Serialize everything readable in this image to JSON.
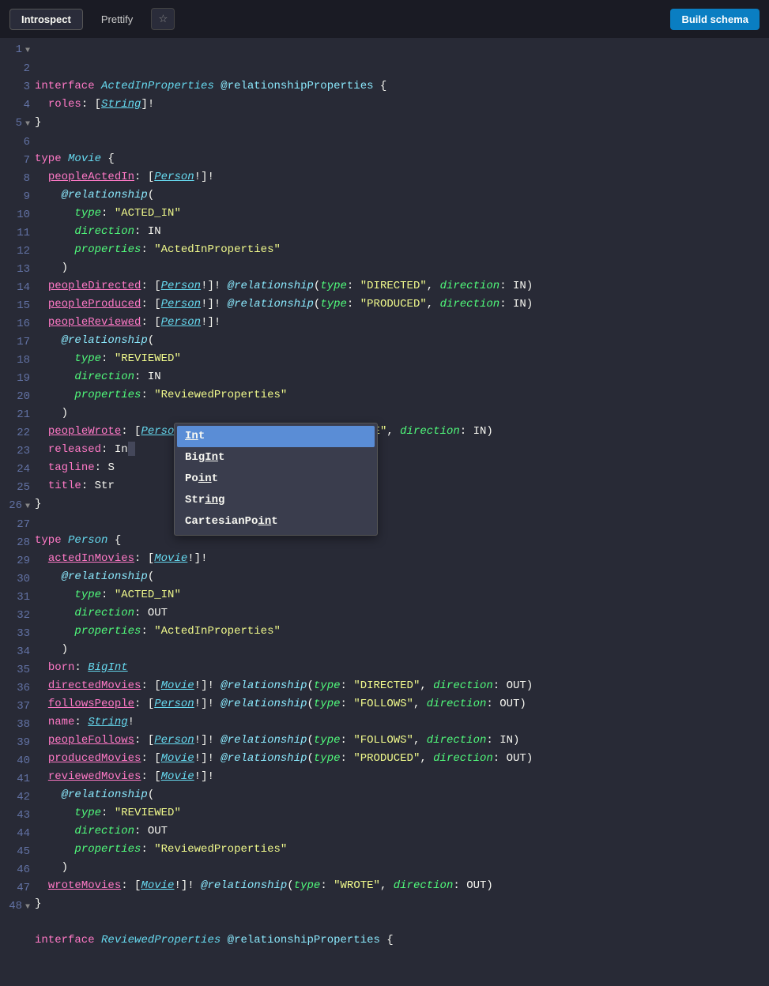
{
  "toolbar": {
    "introspect": "Introspect",
    "prettify": "Prettify",
    "star": "☆",
    "build": "Build schema"
  },
  "lines": [
    {
      "n": 1,
      "fold": true,
      "tokens": [
        [
          "kw",
          "interface"
        ],
        [
          "punc",
          " "
        ],
        [
          "type",
          "ActedInProperties"
        ],
        [
          "punc",
          " "
        ],
        [
          "dir",
          "@relationshipProperties"
        ],
        [
          "punc",
          " {"
        ]
      ]
    },
    {
      "n": 2,
      "tokens": [
        [
          "punc",
          "  "
        ],
        [
          "field",
          "roles"
        ],
        [
          "punc",
          ": ["
        ],
        [
          "ref",
          "String"
        ],
        [
          "punc",
          "]!"
        ]
      ]
    },
    {
      "n": 3,
      "tokens": [
        [
          "punc",
          "}"
        ]
      ]
    },
    {
      "n": 4,
      "tokens": []
    },
    {
      "n": 5,
      "fold": true,
      "tokens": [
        [
          "kw",
          "type"
        ],
        [
          "punc",
          " "
        ],
        [
          "type",
          "Movie"
        ],
        [
          "punc",
          " {"
        ]
      ]
    },
    {
      "n": 6,
      "tokens": [
        [
          "punc",
          "  "
        ],
        [
          "fieldp",
          "peopleActedIn"
        ],
        [
          "punc",
          ": ["
        ],
        [
          "ref",
          "Person"
        ],
        [
          "punc",
          "!]!"
        ]
      ]
    },
    {
      "n": 7,
      "tokens": [
        [
          "punc",
          "    "
        ],
        [
          "dirkw",
          "@relationship"
        ],
        [
          "punc",
          "("
        ]
      ]
    },
    {
      "n": 8,
      "tokens": [
        [
          "punc",
          "      "
        ],
        [
          "attr",
          "type"
        ],
        [
          "punc",
          ": "
        ],
        [
          "str",
          "\"ACTED_IN\""
        ]
      ]
    },
    {
      "n": 9,
      "tokens": [
        [
          "punc",
          "      "
        ],
        [
          "attr",
          "direction"
        ],
        [
          "punc",
          ": "
        ],
        [
          "val",
          "IN"
        ]
      ]
    },
    {
      "n": 10,
      "tokens": [
        [
          "punc",
          "      "
        ],
        [
          "attr",
          "properties"
        ],
        [
          "punc",
          ": "
        ],
        [
          "str",
          "\"ActedInProperties\""
        ]
      ]
    },
    {
      "n": 11,
      "tokens": [
        [
          "punc",
          "    )"
        ]
      ]
    },
    {
      "n": 12,
      "tokens": [
        [
          "punc",
          "  "
        ],
        [
          "fieldp",
          "peopleDirected"
        ],
        [
          "punc",
          ": ["
        ],
        [
          "ref",
          "Person"
        ],
        [
          "punc",
          "!]! "
        ],
        [
          "dirkw",
          "@relationship"
        ],
        [
          "punc",
          "("
        ],
        [
          "attr",
          "type"
        ],
        [
          "punc",
          ": "
        ],
        [
          "str",
          "\"DIRECTED\""
        ],
        [
          "punc",
          ", "
        ],
        [
          "attr",
          "direction"
        ],
        [
          "punc",
          ": "
        ],
        [
          "val",
          "IN"
        ],
        [
          "punc",
          ")"
        ]
      ]
    },
    {
      "n": 13,
      "tokens": [
        [
          "punc",
          "  "
        ],
        [
          "fieldp",
          "peopleProduced"
        ],
        [
          "punc",
          ": ["
        ],
        [
          "ref",
          "Person"
        ],
        [
          "punc",
          "!]! "
        ],
        [
          "dirkw",
          "@relationship"
        ],
        [
          "punc",
          "("
        ],
        [
          "attr",
          "type"
        ],
        [
          "punc",
          ": "
        ],
        [
          "str",
          "\"PRODUCED\""
        ],
        [
          "punc",
          ", "
        ],
        [
          "attr",
          "direction"
        ],
        [
          "punc",
          ": "
        ],
        [
          "val",
          "IN"
        ],
        [
          "punc",
          ")"
        ]
      ]
    },
    {
      "n": 14,
      "tokens": [
        [
          "punc",
          "  "
        ],
        [
          "fieldp",
          "peopleReviewed"
        ],
        [
          "punc",
          ": ["
        ],
        [
          "ref",
          "Person"
        ],
        [
          "punc",
          "!]!"
        ]
      ]
    },
    {
      "n": 15,
      "tokens": [
        [
          "punc",
          "    "
        ],
        [
          "dirkw",
          "@relationship"
        ],
        [
          "punc",
          "("
        ]
      ]
    },
    {
      "n": 16,
      "tokens": [
        [
          "punc",
          "      "
        ],
        [
          "attr",
          "type"
        ],
        [
          "punc",
          ": "
        ],
        [
          "str",
          "\"REVIEWED\""
        ]
      ]
    },
    {
      "n": 17,
      "tokens": [
        [
          "punc",
          "      "
        ],
        [
          "attr",
          "direction"
        ],
        [
          "punc",
          ": "
        ],
        [
          "val",
          "IN"
        ]
      ]
    },
    {
      "n": 18,
      "tokens": [
        [
          "punc",
          "      "
        ],
        [
          "attr",
          "properties"
        ],
        [
          "punc",
          ": "
        ],
        [
          "str",
          "\"ReviewedProperties\""
        ]
      ]
    },
    {
      "n": 19,
      "tokens": [
        [
          "punc",
          "    )"
        ]
      ]
    },
    {
      "n": 20,
      "tokens": [
        [
          "punc",
          "  "
        ],
        [
          "fieldp",
          "peopleWrote"
        ],
        [
          "punc",
          ": ["
        ],
        [
          "ref",
          "Person"
        ],
        [
          "punc",
          "!]! "
        ],
        [
          "dirkw",
          "@relationship"
        ],
        [
          "punc",
          "("
        ],
        [
          "attr",
          "type"
        ],
        [
          "punc",
          ": "
        ],
        [
          "str",
          "\"WROTE\""
        ],
        [
          "punc",
          ", "
        ],
        [
          "attr",
          "direction"
        ],
        [
          "punc",
          ": "
        ],
        [
          "val",
          "IN"
        ],
        [
          "punc",
          ")"
        ]
      ]
    },
    {
      "n": 21,
      "tokens": [
        [
          "punc",
          "  "
        ],
        [
          "field",
          "released"
        ],
        [
          "punc",
          ": "
        ],
        [
          "val",
          "In"
        ],
        [
          "cursor",
          ""
        ]
      ]
    },
    {
      "n": 22,
      "tokens": [
        [
          "punc",
          "  "
        ],
        [
          "field",
          "tagline"
        ],
        [
          "punc",
          ": "
        ],
        [
          "val",
          "S"
        ]
      ]
    },
    {
      "n": 23,
      "tokens": [
        [
          "punc",
          "  "
        ],
        [
          "field",
          "title"
        ],
        [
          "punc",
          ": "
        ],
        [
          "val",
          "Str"
        ]
      ]
    },
    {
      "n": 24,
      "tokens": [
        [
          "punc",
          "}"
        ]
      ]
    },
    {
      "n": 25,
      "tokens": []
    },
    {
      "n": 26,
      "fold": true,
      "tokens": [
        [
          "kw",
          "type"
        ],
        [
          "punc",
          " "
        ],
        [
          "type",
          "Person"
        ],
        [
          "punc",
          " {"
        ]
      ]
    },
    {
      "n": 27,
      "tokens": [
        [
          "punc",
          "  "
        ],
        [
          "fieldp",
          "actedInMovies"
        ],
        [
          "punc",
          ": ["
        ],
        [
          "ref",
          "Movie"
        ],
        [
          "punc",
          "!]!"
        ]
      ]
    },
    {
      "n": 28,
      "tokens": [
        [
          "punc",
          "    "
        ],
        [
          "dirkw",
          "@relationship"
        ],
        [
          "punc",
          "("
        ]
      ]
    },
    {
      "n": 29,
      "tokens": [
        [
          "punc",
          "      "
        ],
        [
          "attr",
          "type"
        ],
        [
          "punc",
          ": "
        ],
        [
          "str",
          "\"ACTED_IN\""
        ]
      ]
    },
    {
      "n": 30,
      "tokens": [
        [
          "punc",
          "      "
        ],
        [
          "attr",
          "direction"
        ],
        [
          "punc",
          ": "
        ],
        [
          "val",
          "OUT"
        ]
      ]
    },
    {
      "n": 31,
      "tokens": [
        [
          "punc",
          "      "
        ],
        [
          "attr",
          "properties"
        ],
        [
          "punc",
          ": "
        ],
        [
          "str",
          "\"ActedInProperties\""
        ]
      ]
    },
    {
      "n": 32,
      "tokens": [
        [
          "punc",
          "    )"
        ]
      ]
    },
    {
      "n": 33,
      "tokens": [
        [
          "punc",
          "  "
        ],
        [
          "field",
          "born"
        ],
        [
          "punc",
          ": "
        ],
        [
          "ref",
          "BigInt"
        ]
      ]
    },
    {
      "n": 34,
      "tokens": [
        [
          "punc",
          "  "
        ],
        [
          "fieldp",
          "directedMovies"
        ],
        [
          "punc",
          ": ["
        ],
        [
          "ref",
          "Movie"
        ],
        [
          "punc",
          "!]! "
        ],
        [
          "dirkw",
          "@relationship"
        ],
        [
          "punc",
          "("
        ],
        [
          "attr",
          "type"
        ],
        [
          "punc",
          ": "
        ],
        [
          "str",
          "\"DIRECTED\""
        ],
        [
          "punc",
          ", "
        ],
        [
          "attr",
          "direction"
        ],
        [
          "punc",
          ": "
        ],
        [
          "val",
          "OUT"
        ],
        [
          "punc",
          ")"
        ]
      ]
    },
    {
      "n": 35,
      "tokens": [
        [
          "punc",
          "  "
        ],
        [
          "fieldp",
          "followsPeople"
        ],
        [
          "punc",
          ": ["
        ],
        [
          "ref",
          "Person"
        ],
        [
          "punc",
          "!]! "
        ],
        [
          "dirkw",
          "@relationship"
        ],
        [
          "punc",
          "("
        ],
        [
          "attr",
          "type"
        ],
        [
          "punc",
          ": "
        ],
        [
          "str",
          "\"FOLLOWS\""
        ],
        [
          "punc",
          ", "
        ],
        [
          "attr",
          "direction"
        ],
        [
          "punc",
          ": "
        ],
        [
          "val",
          "OUT"
        ],
        [
          "punc",
          ")"
        ]
      ]
    },
    {
      "n": 36,
      "tokens": [
        [
          "punc",
          "  "
        ],
        [
          "field",
          "name"
        ],
        [
          "punc",
          ": "
        ],
        [
          "ref",
          "String"
        ],
        [
          "punc",
          "!"
        ]
      ]
    },
    {
      "n": 37,
      "tokens": [
        [
          "punc",
          "  "
        ],
        [
          "fieldp",
          "peopleFollows"
        ],
        [
          "punc",
          ": ["
        ],
        [
          "ref",
          "Person"
        ],
        [
          "punc",
          "!]! "
        ],
        [
          "dirkw",
          "@relationship"
        ],
        [
          "punc",
          "("
        ],
        [
          "attr",
          "type"
        ],
        [
          "punc",
          ": "
        ],
        [
          "str",
          "\"FOLLOWS\""
        ],
        [
          "punc",
          ", "
        ],
        [
          "attr",
          "direction"
        ],
        [
          "punc",
          ": "
        ],
        [
          "val",
          "IN"
        ],
        [
          "punc",
          ")"
        ]
      ]
    },
    {
      "n": 38,
      "tokens": [
        [
          "punc",
          "  "
        ],
        [
          "fieldp",
          "producedMovies"
        ],
        [
          "punc",
          ": ["
        ],
        [
          "ref",
          "Movie"
        ],
        [
          "punc",
          "!]! "
        ],
        [
          "dirkw",
          "@relationship"
        ],
        [
          "punc",
          "("
        ],
        [
          "attr",
          "type"
        ],
        [
          "punc",
          ": "
        ],
        [
          "str",
          "\"PRODUCED\""
        ],
        [
          "punc",
          ", "
        ],
        [
          "attr",
          "direction"
        ],
        [
          "punc",
          ": "
        ],
        [
          "val",
          "OUT"
        ],
        [
          "punc",
          ")"
        ]
      ]
    },
    {
      "n": 39,
      "tokens": [
        [
          "punc",
          "  "
        ],
        [
          "fieldp",
          "reviewedMovies"
        ],
        [
          "punc",
          ": ["
        ],
        [
          "ref",
          "Movie"
        ],
        [
          "punc",
          "!]!"
        ]
      ]
    },
    {
      "n": 40,
      "tokens": [
        [
          "punc",
          "    "
        ],
        [
          "dirkw",
          "@relationship"
        ],
        [
          "punc",
          "("
        ]
      ]
    },
    {
      "n": 41,
      "tokens": [
        [
          "punc",
          "      "
        ],
        [
          "attr",
          "type"
        ],
        [
          "punc",
          ": "
        ],
        [
          "str",
          "\"REVIEWED\""
        ]
      ]
    },
    {
      "n": 42,
      "tokens": [
        [
          "punc",
          "      "
        ],
        [
          "attr",
          "direction"
        ],
        [
          "punc",
          ": "
        ],
        [
          "val",
          "OUT"
        ]
      ]
    },
    {
      "n": 43,
      "tokens": [
        [
          "punc",
          "      "
        ],
        [
          "attr",
          "properties"
        ],
        [
          "punc",
          ": "
        ],
        [
          "str",
          "\"ReviewedProperties\""
        ]
      ]
    },
    {
      "n": 44,
      "tokens": [
        [
          "punc",
          "    )"
        ]
      ]
    },
    {
      "n": 45,
      "tokens": [
        [
          "punc",
          "  "
        ],
        [
          "fieldp",
          "wroteMovies"
        ],
        [
          "punc",
          ": ["
        ],
        [
          "ref",
          "Movie"
        ],
        [
          "punc",
          "!]! "
        ],
        [
          "dirkw",
          "@relationship"
        ],
        [
          "punc",
          "("
        ],
        [
          "attr",
          "type"
        ],
        [
          "punc",
          ": "
        ],
        [
          "str",
          "\"WROTE\""
        ],
        [
          "punc",
          ", "
        ],
        [
          "attr",
          "direction"
        ],
        [
          "punc",
          ": "
        ],
        [
          "val",
          "OUT"
        ],
        [
          "punc",
          ")"
        ]
      ]
    },
    {
      "n": 46,
      "tokens": [
        [
          "punc",
          "}"
        ]
      ]
    },
    {
      "n": 47,
      "tokens": []
    },
    {
      "n": 48,
      "fold": true,
      "tokens": [
        [
          "kw",
          "interface"
        ],
        [
          "punc",
          " "
        ],
        [
          "type",
          "ReviewedProperties"
        ],
        [
          "punc",
          " "
        ],
        [
          "dir",
          "@relationshipProperties"
        ],
        [
          "punc",
          " {"
        ]
      ]
    }
  ],
  "autocomplete": {
    "selected": 0,
    "items": [
      {
        "pre": "",
        "match": "In",
        "post": "t"
      },
      {
        "pre": "Big",
        "match": "In",
        "post": "t"
      },
      {
        "pre": "Po",
        "match": "in",
        "post": "t"
      },
      {
        "pre": "Str",
        "match": "ing",
        "post": ""
      },
      {
        "pre": "CartesianPo",
        "match": "in",
        "post": "t"
      }
    ]
  }
}
